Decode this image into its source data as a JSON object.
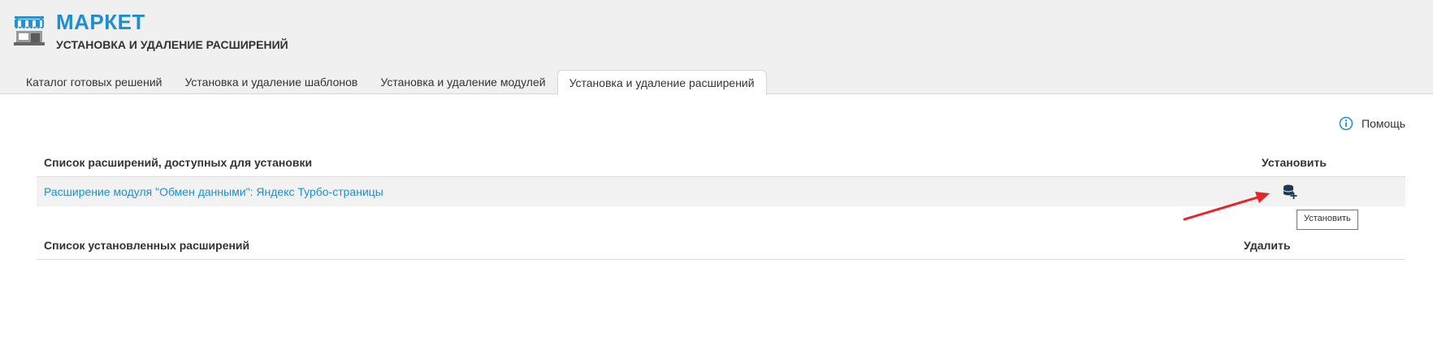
{
  "header": {
    "title": "МАРКЕТ",
    "subtitle": "УСТАНОВКА И УДАЛЕНИЕ РАСШИРЕНИЙ",
    "logo_icon": "market-stall-icon"
  },
  "tabs": [
    {
      "label": "Каталог готовых решений",
      "active": false
    },
    {
      "label": "Установка и удаление шаблонов",
      "active": false
    },
    {
      "label": "Установка и удаление модулей",
      "active": false
    },
    {
      "label": "Установка и удаление расширений",
      "active": true
    }
  ],
  "help": {
    "label": "Помощь",
    "icon": "info-icon"
  },
  "available": {
    "header_label": "Список расширений, доступных для установки",
    "action_label": "Установить",
    "rows": [
      {
        "name": "Расширение модуля \"Обмен данными\": Яндекс Турбо-страницы",
        "action_icon": "database-add-icon"
      }
    ]
  },
  "tooltip": {
    "text": "Установить"
  },
  "installed": {
    "header_label": "Список установленных расширений",
    "action_label": "Удалить"
  },
  "colors": {
    "accent": "#1c8fd0",
    "header_bg": "#f0f0f0",
    "row_bg": "#f2f2f2",
    "annotation_arrow": "#e8232a"
  }
}
